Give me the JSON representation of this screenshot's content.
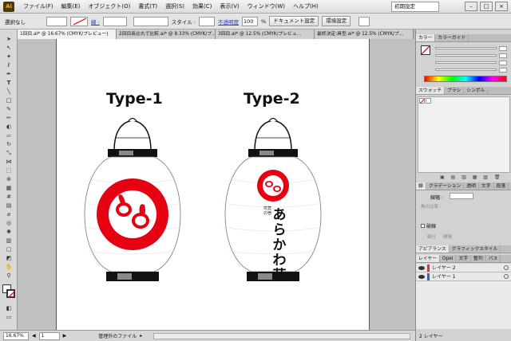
{
  "app": {
    "logo": "Ai"
  },
  "menu": [
    "ファイル(F)",
    "編集(E)",
    "オブジェクト(O)",
    "書式(T)",
    "選択(S)",
    "効果(C)",
    "表示(V)",
    "ウィンドウ(W)",
    "ヘルプ(H)"
  ],
  "workspace": "初期設定",
  "control": {
    "selection_status": "選択なし",
    "stroke_label": "線 :",
    "style_label": "スタイル :",
    "opacity_label": "不透明度",
    "opacity_value": "100",
    "opacity_unit": "%",
    "doc_setup_button": "ドキュメント設定",
    "prefs_button": "環境設定"
  },
  "tabs": [
    "1回目.ai* @ 16.67% (CMYK/プレビュー)",
    "2回目長比丸で比較.ai* @ 8.33% (CMYK/プ...",
    "3回目.ai* @ 12.5% (CMYK/プレビュ...",
    "最終決定:具型.ai* @ 12.5% (CMYK/プ..."
  ],
  "artwork": {
    "type1_title": "Type-1",
    "type2_title": "Type-2",
    "lantern2_small_text": "究竟の宿",
    "lantern2_main_text": "あらかわ荘",
    "brand_red": "#e60012"
  },
  "statusbar": {
    "zoom": "16.67%",
    "page": "1",
    "status_text": "管理外のファイル"
  },
  "panels": {
    "color_tabs": [
      "カラー",
      "カラーガイド"
    ],
    "swatch_tabs": [
      "スウォッチ",
      "ブラシ",
      "シンボル"
    ],
    "stroke_tabs": [
      "線",
      "グラデーション",
      "透明",
      "文字",
      "段落"
    ],
    "stroke_weight_label": "線幅 :",
    "stroke_options": [
      "角の比率 :",
      "破線",
      "線分",
      "間隔"
    ],
    "appearance_tabs": [
      "アピアランス",
      "グラフィックスタイル"
    ],
    "layer_tabs": [
      "レイヤー",
      "Opel",
      "文字",
      "整列",
      "パス"
    ],
    "layers": [
      {
        "name": "レイヤー 2",
        "color": "#e03030"
      },
      {
        "name": "レイヤー 1",
        "color": "#3060e0"
      }
    ],
    "layer_count": "2 レイヤー"
  }
}
